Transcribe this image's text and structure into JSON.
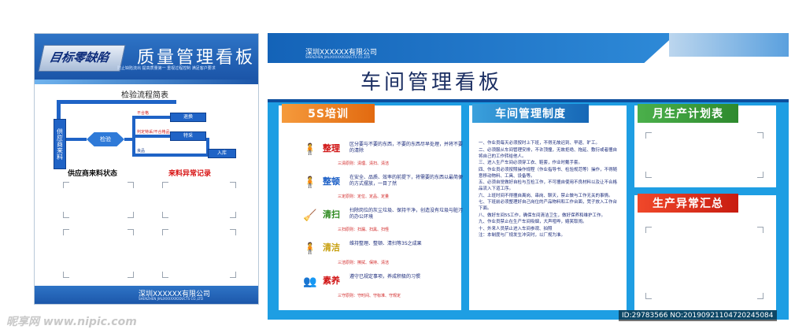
{
  "left_board": {
    "logo_text": "目标零缺陷",
    "title": "质量管理看板",
    "slogan": "防止缺陷流出  提高质量第一  重视过程控制  满足客户要求",
    "flow_title": "检验流程简表",
    "flow": {
      "start": "供应商来料",
      "inspect": "检验",
      "branch_labels": [
        "不合格",
        "判定特采/不合格品",
        "良品"
      ],
      "boxes": [
        "退换",
        "特采",
        "入库"
      ]
    },
    "supplier_status": "供应商来料状态",
    "abnormal_record": "来料异常记录",
    "footer_company": "深圳XXXXXX有限公司",
    "footer_en": "SHENZHEN JIALIXXXXXXODUCTS CO.,LTD"
  },
  "right_board": {
    "company": "深圳XXXXXX有限公司",
    "company_en": "SHENZHEN JIALIXXXXXXODUCTS CO.,LTD",
    "title": "车间管理看板",
    "training": {
      "title": "5S培训",
      "items": [
        {
          "name": "整理",
          "desc": "区分要与不要的东西，不要的东西尽早处理，并将不要的清除",
          "principle": "三清原则：清理、清扫、清洁",
          "icon": "person-sorting-icon"
        },
        {
          "name": "整顿",
          "desc": "在安全、品质、效率的前提下，将需要的东西以最简便的方式摆放，一目了然",
          "principle": "三定原则：定位、定品、定量",
          "icon": "person-arranging-icon"
        },
        {
          "name": "清扫",
          "desc": "扫除岗位的灰尘垃圾、保持干净，创造没有垃圾与脏污的办公环境",
          "principle": "三扫原则：扫漏、扫黑、扫怪",
          "icon": "person-sweeping-icon"
        },
        {
          "name": "清洁",
          "desc": "维持整理、整顿、清扫等3S之成果",
          "principle": "三洁原则：擦拭、保持、清洁",
          "icon": "person-cleaning-icon"
        },
        {
          "name": "素养",
          "desc": "遵守已规定事项，养成积极的习惯",
          "principle": "三守原则：守时间、守标准、守规定",
          "icon": "people-discipline-icon"
        }
      ]
    },
    "rules": {
      "title": "车间管理制度",
      "items": [
        "一、作业员每天必须按时上下班，不得无故迟到、早退、旷工。",
        "二、必须服从车间管理安排，不许顶撞，无故拒绝、拖延、敷衍或者擅自将自己的工作转给他人。",
        "三、进入生产车间必须穿工衣、鞋套，作业时戴手套。",
        "四、作业员必须按照操作规程（作业指导书、检验规范等）操作，不得随意移动物料、工具、设备等。",
        "五、必须自觉做好自检与互检工作，不可擅自使用不良材料以及让不合格品流入下道工序。",
        "六、上班时间不得擅自离岗、串岗、聊天，禁止做与工作无关的事情。",
        "七、下班前必须整理好自己岗位的产品物料和工作台面，凳子放入工作台下面。",
        "八、做好车间5S工作，确保车间清洁卫生，做好保养和维护工作。",
        "九、作业员禁止在生产车间吸烟，大声喧哗，嬉笑取闹。",
        "十、外来人员禁止进入车间参观、拍照",
        "注：本制度与厂规发生冲突时，以厂规为准。"
      ]
    },
    "monthly_plan": "月生产计划表",
    "abnormal_summary": "生产异常汇总"
  },
  "watermark": {
    "site": "昵享网 www.nipic.com",
    "id_text": "ID:29783566 NO:20190921104720245084"
  },
  "colors": {
    "brand_blue": "#1b55a8",
    "board_blue": "#1e9ee3",
    "orange": "#f07b1c",
    "teal": "#1d86c6",
    "green": "#3a9c3a",
    "red": "#d81414"
  }
}
